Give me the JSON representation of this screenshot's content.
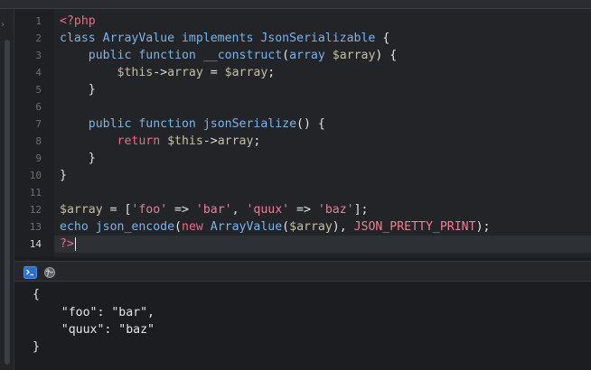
{
  "editor": {
    "line_numbers": [
      "1",
      "2",
      "3",
      "4",
      "5",
      "6",
      "7",
      "8",
      "9",
      "10",
      "11",
      "12",
      "13",
      "14"
    ],
    "active_line": "14",
    "lines": [
      [
        {
          "t": "<?php",
          "c": "tag"
        }
      ],
      [
        {
          "t": "class ",
          "c": "kw"
        },
        {
          "t": "ArrayValue ",
          "c": "kw"
        },
        {
          "t": "implements ",
          "c": "kw"
        },
        {
          "t": "JsonSerializable ",
          "c": "kw"
        },
        {
          "t": "{",
          "c": "plain"
        }
      ],
      [
        {
          "t": "    public ",
          "c": "kw"
        },
        {
          "t": "function ",
          "c": "kw"
        },
        {
          "t": "__construct",
          "c": "fn"
        },
        {
          "t": "(",
          "c": "plain"
        },
        {
          "t": "array ",
          "c": "kw"
        },
        {
          "t": "$array",
          "c": "var"
        },
        {
          "t": ") {",
          "c": "plain"
        }
      ],
      [
        {
          "t": "        $this",
          "c": "var"
        },
        {
          "t": "->",
          "c": "arrow"
        },
        {
          "t": "array ",
          "c": "var"
        },
        {
          "t": "= ",
          "c": "plain"
        },
        {
          "t": "$array",
          "c": "var"
        },
        {
          "t": ";",
          "c": "plain"
        }
      ],
      [
        {
          "t": "    }",
          "c": "plain"
        }
      ],
      [
        {
          "t": "",
          "c": "plain"
        }
      ],
      [
        {
          "t": "    public ",
          "c": "kw"
        },
        {
          "t": "function ",
          "c": "kw"
        },
        {
          "t": "jsonSerialize",
          "c": "fn"
        },
        {
          "t": "() {",
          "c": "plain"
        }
      ],
      [
        {
          "t": "        return ",
          "c": "ret"
        },
        {
          "t": "$this",
          "c": "var"
        },
        {
          "t": "->",
          "c": "arrow"
        },
        {
          "t": "array",
          "c": "var"
        },
        {
          "t": ";",
          "c": "plain"
        }
      ],
      [
        {
          "t": "    }",
          "c": "plain"
        }
      ],
      [
        {
          "t": "}",
          "c": "plain"
        }
      ],
      [
        {
          "t": "",
          "c": "plain"
        }
      ],
      [
        {
          "t": "$array ",
          "c": "var"
        },
        {
          "t": "= [",
          "c": "plain"
        },
        {
          "t": "'foo'",
          "c": "str"
        },
        {
          "t": " => ",
          "c": "plain"
        },
        {
          "t": "'bar'",
          "c": "str"
        },
        {
          "t": ", ",
          "c": "plain"
        },
        {
          "t": "'quux'",
          "c": "str"
        },
        {
          "t": " => ",
          "c": "plain"
        },
        {
          "t": "'baz'",
          "c": "str"
        },
        {
          "t": "];",
          "c": "plain"
        }
      ],
      [
        {
          "t": "echo ",
          "c": "kw"
        },
        {
          "t": "json_encode",
          "c": "fn"
        },
        {
          "t": "(",
          "c": "plain"
        },
        {
          "t": "new ",
          "c": "ret"
        },
        {
          "t": "ArrayValue",
          "c": "kw"
        },
        {
          "t": "(",
          "c": "plain"
        },
        {
          "t": "$array",
          "c": "var"
        },
        {
          "t": "), ",
          "c": "plain"
        },
        {
          "t": "JSON_PRETTY_PRINT",
          "c": "const"
        },
        {
          "t": ");",
          "c": "plain"
        }
      ],
      [
        {
          "t": "?>",
          "c": "tag"
        }
      ]
    ]
  },
  "console": {
    "terminal_icon": "terminal-icon",
    "globe_icon": "globe-icon",
    "output_lines": [
      "{",
      "    \"foo\": \"bar\",",
      "    \"quux\": \"baz\"",
      "}"
    ]
  },
  "colors": {
    "background": "#1b1d21",
    "keyword": "#7ab4ea",
    "tag": "#f06a85",
    "string": "#f07d93",
    "variable": "#c9bfa5"
  }
}
